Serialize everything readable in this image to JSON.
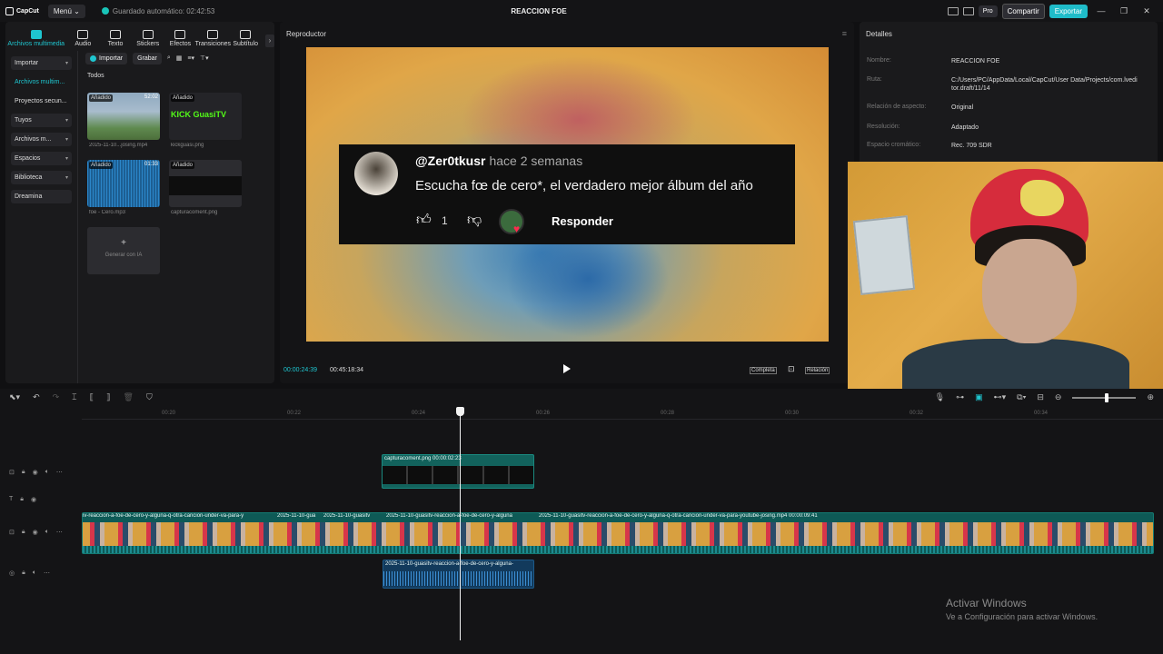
{
  "titlebar": {
    "logo": "CapCut",
    "menu": "Menú",
    "autosave": "Guardado automático: 02:42:53",
    "project_title": "REACCION FOE",
    "pro": "Pro",
    "share": "Compartir",
    "export": "Exportar"
  },
  "toolbar": {
    "tools": [
      {
        "label": "Archivos multimedia",
        "icon": "media-icon"
      },
      {
        "label": "Audio",
        "icon": "audio-icon"
      },
      {
        "label": "Texto",
        "icon": "text-icon"
      },
      {
        "label": "Stickers",
        "icon": "sticker-icon"
      },
      {
        "label": "Efectos",
        "icon": "effects-icon"
      },
      {
        "label": "Transiciones",
        "icon": "transitions-icon"
      },
      {
        "label": "Subtítulo",
        "icon": "subtitle-icon"
      }
    ]
  },
  "sidebar": {
    "items": [
      {
        "label": "Importar"
      },
      {
        "label": "Archivos multim..."
      },
      {
        "label": "Proyectos secun..."
      },
      {
        "label": "Tuyos"
      },
      {
        "label": "Archivos m..."
      },
      {
        "label": "Espacios"
      },
      {
        "label": "Biblioteca"
      },
      {
        "label": "Dreamina"
      }
    ]
  },
  "media": {
    "import_label": "Importar",
    "record_label": "Grabar",
    "section": "Todos",
    "items": [
      {
        "tag": "Añadido",
        "duration": "52:02",
        "caption": "2025-11-10...josing.mp4"
      },
      {
        "tag": "Añadido",
        "duration": "",
        "caption": "kickguasi.png",
        "logo_text": "KICK GuasiTV"
      },
      {
        "tag": "Añadido",
        "duration": "01:33",
        "caption": "foe - Cero.mp3"
      },
      {
        "tag": "Añadido",
        "duration": "",
        "caption": "capturacoment.png"
      }
    ],
    "ai_label": "Generar con IA"
  },
  "player": {
    "title": "Reproductor",
    "current_time": "00:00:24:39",
    "total_time": "00:45:18:34",
    "full_label": "Completa",
    "ratio_label": "Relación",
    "comment": {
      "user": "@Zer0tkusr",
      "time": "hace 2 semanas",
      "text": "Escucha fœ de cero*, el verdadero mejor álbum del año",
      "likes": "1",
      "reply": "Responder"
    }
  },
  "details": {
    "title": "Detalles",
    "rows": [
      {
        "key": "Nombre:",
        "value": "REACCION FOE"
      },
      {
        "key": "Ruta:",
        "value": "C:/Users/PC/AppData/Local/CapCut/User Data/Projects/com.lveditor.draft/11/14"
      },
      {
        "key": "Relación de aspecto:",
        "value": "Original"
      },
      {
        "key": "Resolución:",
        "value": "Adaptado"
      },
      {
        "key": "Espacio cromático:",
        "value": "Rec. 709 SDR"
      }
    ]
  },
  "timeline": {
    "ticks": [
      "00:20",
      "00:22",
      "00:24",
      "00:26",
      "00:28",
      "00:30",
      "00:32",
      "00:34"
    ],
    "image_clip": "capturacoment.png  00:00:02:23",
    "main_segments": [
      "iv-reaccion-a-foe-de-cero-y-alguna-q-otra-cancion-under-va-para-y",
      "2025-11-10-gua",
      "2025-11-10-guasitv",
      "2025-11-10-guasitv-reaccion-a-foe-de-cero-y-alguna",
      "2025-11-10-guasitv-reaccion-a-foe-de-cero-y-alguna-q-otra-cancion-under-va-para-youtube-josing.mp4  00:00:09:41"
    ],
    "audio_clip": "2025-11-10-guasitv-reaccion-a-foe-de-cero-y-alguna-"
  },
  "watermark": {
    "line1": "Activar Windows",
    "line2": "Ve a Configuración para activar Windows."
  },
  "colors": {
    "accent": "#1fc6d0",
    "clip_teal": "#0e5a56",
    "audio_blue": "#123a5c"
  }
}
